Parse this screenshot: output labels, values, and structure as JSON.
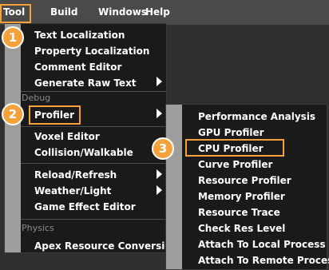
{
  "menubar": {
    "items": [
      {
        "label": "Tool"
      },
      {
        "label": "Build"
      },
      {
        "label": "Windows"
      },
      {
        "label": "Help"
      }
    ]
  },
  "tool_menu": {
    "items": [
      {
        "label": "Text Localization"
      },
      {
        "label": "Property Localization"
      },
      {
        "label": "Comment Editor"
      },
      {
        "label": "Generate Raw Text"
      }
    ],
    "debug_section": "Debug",
    "debug_items": [
      {
        "label": "Profiler"
      },
      {
        "label": "Voxel Editor"
      },
      {
        "label": "Collision/Walkable"
      },
      {
        "label": "Reload/Refresh"
      },
      {
        "label": "Weather/Light"
      },
      {
        "label": "Game Effect Editor"
      }
    ],
    "physics_section": "Physics",
    "physics_items": [
      {
        "label": "Apex Resource Conversion"
      }
    ]
  },
  "profiler_submenu": {
    "items": [
      {
        "label": "Performance Analysis"
      },
      {
        "label": "GPU Profiler"
      },
      {
        "label": "CPU Profiler"
      },
      {
        "label": "Curve Profiler"
      },
      {
        "label": "Resource Profiler"
      },
      {
        "label": "Memory Profiler"
      },
      {
        "label": "Resource Trace"
      },
      {
        "label": "Check Res Level"
      },
      {
        "label": "Attach To Local Process"
      },
      {
        "label": "Attach To Remote Process"
      }
    ]
  },
  "badges": [
    "1",
    "2",
    "3"
  ],
  "colors": {
    "highlight": "#f5a23c",
    "menu_bg": "#1a1a1a",
    "menubar_bg": "#4a4a4a",
    "strip": "#9e9e9e"
  }
}
